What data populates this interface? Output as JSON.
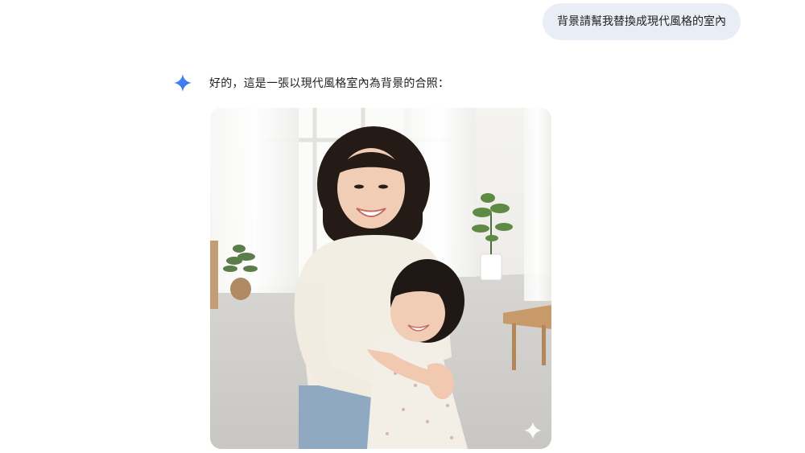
{
  "conversation": {
    "user_message": "背景請幫我替換成現代風格的室內",
    "assistant_message": "好的，這是一張以現代風格室內為背景的合照：",
    "assistant_icon": "gemini-sparkle-icon",
    "image_watermark_icon": "sparkle-watermark-icon"
  },
  "theme": {
    "bubble_bg": "#e9eef6",
    "text_color": "#1f1f1f",
    "sparkle_blue": "#4285f4"
  }
}
